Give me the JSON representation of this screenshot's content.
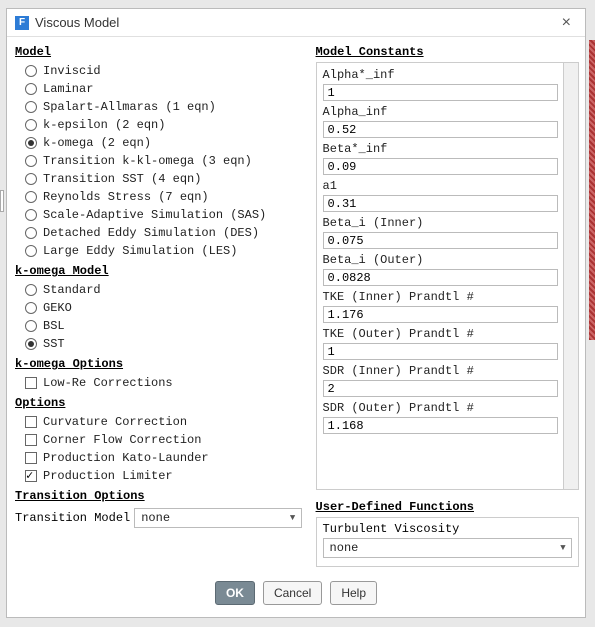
{
  "window": {
    "title": "Viscous Model"
  },
  "sections": {
    "model": "Model",
    "komega_model": "k-omega Model",
    "komega_options": "k-omega Options",
    "options": "Options",
    "transition": "Transition Options",
    "constants": "Model Constants",
    "udf": "User-Defined Functions"
  },
  "model": {
    "items": [
      "Inviscid",
      "Laminar",
      "Spalart-Allmaras (1 eqn)",
      "k-epsilon (2 eqn)",
      "k-omega (2 eqn)",
      "Transition k-kl-omega (3 eqn)",
      "Transition SST (4 eqn)",
      "Reynolds Stress (7 eqn)",
      "Scale-Adaptive Simulation (SAS)",
      "Detached Eddy Simulation (DES)",
      "Large Eddy Simulation (LES)"
    ],
    "selected": 4
  },
  "komega_model": {
    "items": [
      "Standard",
      "GEKO",
      "BSL",
      "SST"
    ],
    "selected": 3
  },
  "komega_options": {
    "items": [
      "Low-Re Corrections"
    ],
    "checked": []
  },
  "options_group": {
    "items": [
      "Curvature Correction",
      "Corner Flow Correction",
      "Production Kato-Launder",
      "Production Limiter"
    ],
    "checked": [
      3
    ]
  },
  "transition": {
    "label": "Transition Model",
    "value": "none"
  },
  "constants": [
    {
      "label": "Alpha*_inf",
      "value": "1"
    },
    {
      "label": "Alpha_inf",
      "value": "0.52"
    },
    {
      "label": "Beta*_inf",
      "value": "0.09"
    },
    {
      "label": "a1",
      "value": "0.31"
    },
    {
      "label": "Beta_i (Inner)",
      "value": "0.075"
    },
    {
      "label": "Beta_i (Outer)",
      "value": "0.0828"
    },
    {
      "label": "TKE (Inner) Prandtl #",
      "value": "1.176"
    },
    {
      "label": "TKE (Outer) Prandtl #",
      "value": "1"
    },
    {
      "label": "SDR (Inner) Prandtl #",
      "value": "2"
    },
    {
      "label": "SDR (Outer) Prandtl #",
      "value": "1.168"
    }
  ],
  "udf": {
    "label": "Turbulent Viscosity",
    "value": "none"
  },
  "buttons": {
    "ok": "OK",
    "cancel": "Cancel",
    "help": "Help"
  }
}
